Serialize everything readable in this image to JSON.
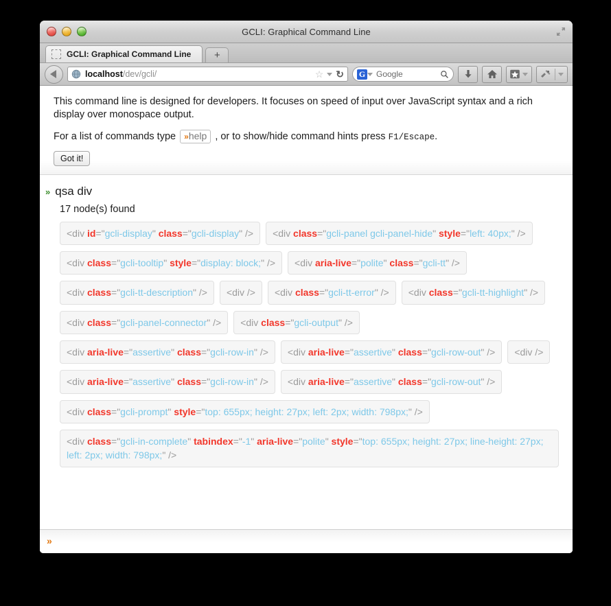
{
  "window": {
    "title": "GCLI: Graphical Command Line",
    "fullscreen_icon": "fullscreen-arrows-icon",
    "traffic_lights": [
      "close-button",
      "minimize-button",
      "zoom-button"
    ]
  },
  "tabbar": {
    "tab_label": "GCLI: Graphical Command Line",
    "favicon": "placeholder-favicon-icon",
    "new_tab_label": "+"
  },
  "navbar": {
    "back_icon": "back-arrow-icon",
    "url_icon": "globe-icon",
    "url_host": "localhost",
    "url_path": "/dev/gcli/",
    "bookmark_star": "☆",
    "dropdown_caret": "chevron-down-icon",
    "reload_glyph": "↻",
    "search_engine_letter": "G",
    "search_placeholder": "Google",
    "search_icon": "magnifier-icon",
    "buttons": [
      {
        "name": "downloads-button",
        "icon": "download-arrow-icon"
      },
      {
        "name": "home-button",
        "icon": "home-icon"
      },
      {
        "name": "bookmarks-button",
        "icon": "star-bookmark-icon"
      },
      {
        "name": "tools-button",
        "icon": "tools-icon"
      }
    ]
  },
  "intro": {
    "paragraph1": "This command line is designed for developers. It focuses on speed of input over JavaScript syntax and a rich display over monospace output.",
    "line2_prefix": "For a list of commands type",
    "help_chip_prefix": "»",
    "help_chip_label": "help",
    "line2_middle": ", or to show/hide command hints press",
    "line2_keys": "F1/Escape",
    "line2_suffix": ".",
    "got_it_label": "Got it!"
  },
  "output": {
    "prompt_glyph": "»",
    "command": "qsa div",
    "result_summary": "17 node(s) found",
    "nodes": [
      {
        "full": false,
        "tokens": [
          {
            "t": "tag",
            "s": "<div "
          },
          {
            "t": "attr",
            "s": "id"
          },
          {
            "t": "eq",
            "s": "=\""
          },
          {
            "t": "val",
            "s": "gcli-display"
          },
          {
            "t": "eq",
            "s": "\" "
          },
          {
            "t": "attr",
            "s": "class"
          },
          {
            "t": "eq",
            "s": "=\""
          },
          {
            "t": "val",
            "s": "gcli-display"
          },
          {
            "t": "tag",
            "s": "\" />"
          }
        ]
      },
      {
        "full": false,
        "tokens": [
          {
            "t": "tag",
            "s": "<div "
          },
          {
            "t": "attr",
            "s": "class"
          },
          {
            "t": "eq",
            "s": "=\""
          },
          {
            "t": "val",
            "s": "gcli-panel gcli-panel-hide"
          },
          {
            "t": "eq",
            "s": "\" "
          },
          {
            "t": "attr",
            "s": "style"
          },
          {
            "t": "eq",
            "s": "=\""
          },
          {
            "t": "val",
            "s": "left: 40px;"
          },
          {
            "t": "tag",
            "s": "\" />"
          }
        ]
      },
      {
        "full": false,
        "tokens": [
          {
            "t": "tag",
            "s": "<div "
          },
          {
            "t": "attr",
            "s": "class"
          },
          {
            "t": "eq",
            "s": "=\""
          },
          {
            "t": "val",
            "s": "gcli-tooltip"
          },
          {
            "t": "eq",
            "s": "\" "
          },
          {
            "t": "attr",
            "s": "style"
          },
          {
            "t": "eq",
            "s": "=\""
          },
          {
            "t": "val",
            "s": "display: block;"
          },
          {
            "t": "tag",
            "s": "\" />"
          }
        ]
      },
      {
        "full": false,
        "tokens": [
          {
            "t": "tag",
            "s": "<div "
          },
          {
            "t": "attr",
            "s": "aria-live"
          },
          {
            "t": "eq",
            "s": "=\""
          },
          {
            "t": "val",
            "s": "polite"
          },
          {
            "t": "eq",
            "s": "\" "
          },
          {
            "t": "attr",
            "s": "class"
          },
          {
            "t": "eq",
            "s": "=\""
          },
          {
            "t": "val",
            "s": "gcli-tt"
          },
          {
            "t": "tag",
            "s": "\" />"
          }
        ]
      },
      {
        "full": false,
        "tokens": [
          {
            "t": "tag",
            "s": "<div "
          },
          {
            "t": "attr",
            "s": "class"
          },
          {
            "t": "eq",
            "s": "=\""
          },
          {
            "t": "val",
            "s": "gcli-tt-description"
          },
          {
            "t": "tag",
            "s": "\" />"
          }
        ]
      },
      {
        "full": false,
        "tokens": [
          {
            "t": "tag",
            "s": "<div />"
          }
        ]
      },
      {
        "full": false,
        "tokens": [
          {
            "t": "tag",
            "s": "<div "
          },
          {
            "t": "attr",
            "s": "class"
          },
          {
            "t": "eq",
            "s": "=\""
          },
          {
            "t": "val",
            "s": "gcli-tt-error"
          },
          {
            "t": "tag",
            "s": "\" />"
          }
        ]
      },
      {
        "full": false,
        "tokens": [
          {
            "t": "tag",
            "s": "<div "
          },
          {
            "t": "attr",
            "s": "class"
          },
          {
            "t": "eq",
            "s": "=\""
          },
          {
            "t": "val",
            "s": "gcli-tt-highlight"
          },
          {
            "t": "tag",
            "s": "\" />"
          }
        ]
      },
      {
        "full": false,
        "tokens": [
          {
            "t": "tag",
            "s": "<div "
          },
          {
            "t": "attr",
            "s": "class"
          },
          {
            "t": "eq",
            "s": "=\""
          },
          {
            "t": "val",
            "s": "gcli-panel-connector"
          },
          {
            "t": "tag",
            "s": "\" />"
          }
        ]
      },
      {
        "full": false,
        "tokens": [
          {
            "t": "tag",
            "s": "<div "
          },
          {
            "t": "attr",
            "s": "class"
          },
          {
            "t": "eq",
            "s": "=\""
          },
          {
            "t": "val",
            "s": "gcli-output"
          },
          {
            "t": "tag",
            "s": "\" />"
          }
        ]
      },
      {
        "full": false,
        "tokens": [
          {
            "t": "tag",
            "s": "<div "
          },
          {
            "t": "attr",
            "s": "aria-live"
          },
          {
            "t": "eq",
            "s": "=\""
          },
          {
            "t": "val",
            "s": "assertive"
          },
          {
            "t": "eq",
            "s": "\" "
          },
          {
            "t": "attr",
            "s": "class"
          },
          {
            "t": "eq",
            "s": "=\""
          },
          {
            "t": "val",
            "s": "gcli-row-in"
          },
          {
            "t": "tag",
            "s": "\" />"
          }
        ]
      },
      {
        "full": false,
        "tokens": [
          {
            "t": "tag",
            "s": "<div "
          },
          {
            "t": "attr",
            "s": "aria-live"
          },
          {
            "t": "eq",
            "s": "=\""
          },
          {
            "t": "val",
            "s": "assertive"
          },
          {
            "t": "eq",
            "s": "\" "
          },
          {
            "t": "attr",
            "s": "class"
          },
          {
            "t": "eq",
            "s": "=\""
          },
          {
            "t": "val",
            "s": "gcli-row-out"
          },
          {
            "t": "tag",
            "s": "\" />"
          }
        ]
      },
      {
        "full": false,
        "tokens": [
          {
            "t": "tag",
            "s": "<div />"
          }
        ]
      },
      {
        "full": false,
        "tokens": [
          {
            "t": "tag",
            "s": "<div "
          },
          {
            "t": "attr",
            "s": "aria-live"
          },
          {
            "t": "eq",
            "s": "=\""
          },
          {
            "t": "val",
            "s": "assertive"
          },
          {
            "t": "eq",
            "s": "\" "
          },
          {
            "t": "attr",
            "s": "class"
          },
          {
            "t": "eq",
            "s": "=\""
          },
          {
            "t": "val",
            "s": "gcli-row-in"
          },
          {
            "t": "tag",
            "s": "\" />"
          }
        ]
      },
      {
        "full": false,
        "tokens": [
          {
            "t": "tag",
            "s": "<div "
          },
          {
            "t": "attr",
            "s": "aria-live"
          },
          {
            "t": "eq",
            "s": "=\""
          },
          {
            "t": "val",
            "s": "assertive"
          },
          {
            "t": "eq",
            "s": "\" "
          },
          {
            "t": "attr",
            "s": "class"
          },
          {
            "t": "eq",
            "s": "=\""
          },
          {
            "t": "val",
            "s": "gcli-row-out"
          },
          {
            "t": "tag",
            "s": "\" />"
          }
        ]
      },
      {
        "full": false,
        "tokens": [
          {
            "t": "tag",
            "s": "<div "
          },
          {
            "t": "attr",
            "s": "class"
          },
          {
            "t": "eq",
            "s": "=\""
          },
          {
            "t": "val",
            "s": "gcli-prompt"
          },
          {
            "t": "eq",
            "s": "\" "
          },
          {
            "t": "attr",
            "s": "style"
          },
          {
            "t": "eq",
            "s": "=\""
          },
          {
            "t": "val",
            "s": "top: 655px; height: 27px; left: 2px; width: 798px;"
          },
          {
            "t": "tag",
            "s": "\" />"
          }
        ]
      },
      {
        "full": true,
        "tokens": [
          {
            "t": "tag",
            "s": "<div "
          },
          {
            "t": "attr",
            "s": "class"
          },
          {
            "t": "eq",
            "s": "=\""
          },
          {
            "t": "val",
            "s": "gcli-in-complete"
          },
          {
            "t": "eq",
            "s": "\" "
          },
          {
            "t": "attr",
            "s": "tabindex"
          },
          {
            "t": "eq",
            "s": "=\""
          },
          {
            "t": "val",
            "s": "-1"
          },
          {
            "t": "eq",
            "s": "\" "
          },
          {
            "t": "attr",
            "s": "aria-live"
          },
          {
            "t": "eq",
            "s": "=\""
          },
          {
            "t": "val",
            "s": "polite"
          },
          {
            "t": "eq",
            "s": "\" "
          },
          {
            "t": "attr",
            "s": "style"
          },
          {
            "t": "eq",
            "s": "=\""
          },
          {
            "t": "val",
            "s": "top: 655px; height: 27px; line-height: 27px; left: 2px; width: 798px;"
          },
          {
            "t": "tag",
            "s": "\" />"
          }
        ]
      }
    ]
  },
  "footer": {
    "prompt_glyph": "»",
    "input_value": ""
  },
  "colors": {
    "attr_red": "#f2372b",
    "value_blue": "#7ec8e8",
    "tag_gray": "#9b9b9b",
    "command_green": "#3f8f2f",
    "prompt_orange": "#e2760e",
    "node_bg": "#f6f6f6"
  }
}
